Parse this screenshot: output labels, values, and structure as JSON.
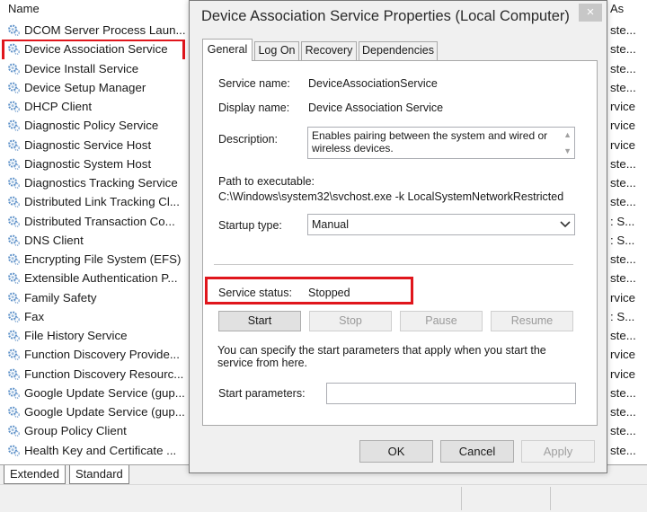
{
  "list": {
    "header": "Name",
    "items": [
      "DCOM Server Process Laun...",
      "Device Association Service",
      "Device Install Service",
      "Device Setup Manager",
      "DHCP Client",
      "Diagnostic Policy Service",
      "Diagnostic Service Host",
      "Diagnostic System Host",
      "Diagnostics Tracking Service",
      "Distributed Link Tracking Cl...",
      "Distributed Transaction Co...",
      "DNS Client",
      "Encrypting File System (EFS)",
      "Extensible Authentication P...",
      "Family Safety",
      "Fax",
      "File History Service",
      "Function Discovery Provide...",
      "Function Discovery Resourc...",
      "Google Update Service (gup...",
      "Google Update Service (gup...",
      "Group Policy Client",
      "Health Key and Certificate ..."
    ],
    "right_header": "As",
    "right_items": [
      "ste...",
      "ste...",
      "ste...",
      "ste...",
      "rvice",
      "rvice",
      "rvice",
      "ste...",
      "ste...",
      "ste...",
      ": S...",
      ": S...",
      "ste...",
      "ste...",
      "rvice",
      ": S...",
      "ste...",
      "rvice",
      "rvice",
      "ste...",
      "ste...",
      "ste...",
      "ste..."
    ]
  },
  "bottom_tabs": {
    "extended": "Extended",
    "standard": "Standard"
  },
  "dialog": {
    "title": "Device Association Service Properties (Local Computer)",
    "close": "×",
    "tabs": [
      "General",
      "Log On",
      "Recovery",
      "Dependencies"
    ],
    "service_name_label": "Service name:",
    "service_name_value": "DeviceAssociationService",
    "display_name_label": "Display name:",
    "display_name_value": "Device Association Service",
    "description_label": "Description:",
    "description_value": "Enables pairing between the system and wired or wireless devices.",
    "path_label": "Path to executable:",
    "path_value": "C:\\Windows\\system32\\svchost.exe -k LocalSystemNetworkRestricted",
    "startup_label": "Startup type:",
    "startup_value": "Manual",
    "status_label": "Service status:",
    "status_value": "Stopped",
    "buttons": {
      "start": "Start",
      "stop": "Stop",
      "pause": "Pause",
      "resume": "Resume"
    },
    "help_text": "You can specify the start parameters that apply when you start the service from here.",
    "params_label": "Start parameters:",
    "params_value": "",
    "ok": "OK",
    "cancel": "Cancel",
    "apply": "Apply"
  },
  "colors": {
    "highlight_frame": "#e0161c",
    "gear_blue": "#5a8fc8"
  }
}
